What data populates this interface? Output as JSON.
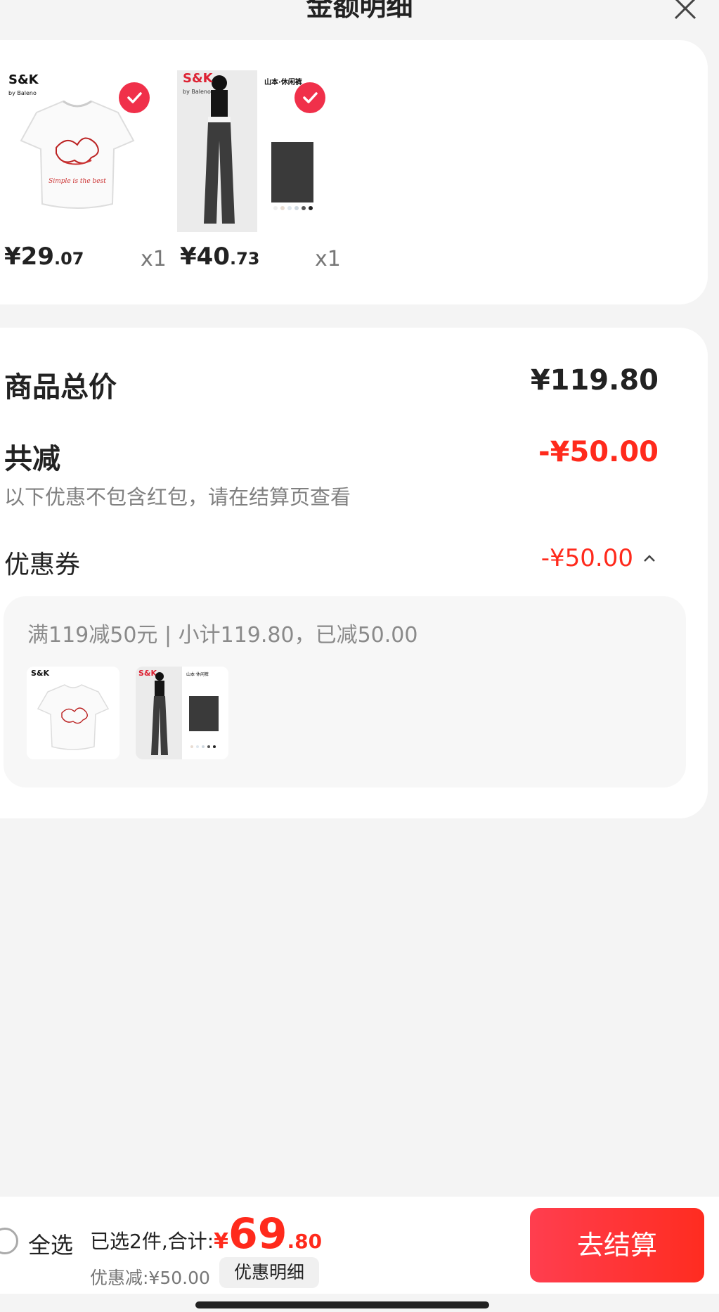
{
  "header": {
    "title": "金额明细"
  },
  "products": [
    {
      "brand": "S&K",
      "brand_sub": "by Baleno",
      "price_int": "¥29",
      "price_dec": ".07",
      "qty": "x1",
      "checked": true
    },
    {
      "brand": "S&K",
      "brand_sub": "by Baleno",
      "tag": "山本·休闲裤",
      "price_int": "¥40",
      "price_dec": ".73",
      "qty": "x1",
      "checked": true
    }
  ],
  "summary": {
    "total_label": "商品总价",
    "total_value": "¥119.80",
    "reduce_label": "共减",
    "reduce_value": "-¥50.00",
    "note": "以下优惠不包含红包，请在结算页查看",
    "coupon_label": "优惠券",
    "coupon_value": "-¥50.00",
    "coupon_desc": "满119减50元 | 小计119.80，已减50.00"
  },
  "bottom": {
    "select_all": "全选",
    "selected_text": "已选2件,合计:",
    "currency": "¥",
    "total_int": "69",
    "total_dec": ".80",
    "discount_text": "优惠减:¥50.00",
    "detail_button": "优惠明细",
    "checkout_button": "去结算"
  },
  "colors": {
    "accent": "#ff2a1c",
    "check": "#f0304a"
  }
}
